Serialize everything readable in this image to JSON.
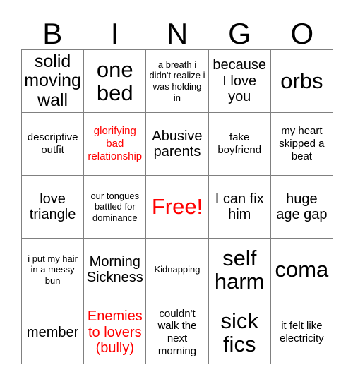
{
  "card": {
    "header_letters": [
      "B",
      "I",
      "N",
      "G",
      "O"
    ],
    "grid_line_color": "#808080",
    "accent_color": "#ff0000",
    "text_color": "#000000",
    "rows": [
      [
        {
          "text": "solid moving wall",
          "color": "black",
          "size": "lg"
        },
        {
          "text": "one bed",
          "color": "black",
          "size": "xl"
        },
        {
          "text": "a breath i didn't realize i was holding in",
          "color": "black",
          "size": "xs"
        },
        {
          "text": "because I love you",
          "color": "black",
          "size": "md"
        },
        {
          "text": "orbs",
          "color": "black",
          "size": "xl"
        }
      ],
      [
        {
          "text": "descriptive outfit",
          "color": "black",
          "size": "sm"
        },
        {
          "text": "glorifying bad relationship",
          "color": "red",
          "size": "sm"
        },
        {
          "text": "Abusive parents",
          "color": "black",
          "size": "md"
        },
        {
          "text": "fake boyfriend",
          "color": "black",
          "size": "sm"
        },
        {
          "text": "my heart skipped a beat",
          "color": "black",
          "size": "sm"
        }
      ],
      [
        {
          "text": "love triangle",
          "color": "black",
          "size": "md"
        },
        {
          "text": "our tongues battled for dominance",
          "color": "black",
          "size": "xs"
        },
        {
          "text": "Free!",
          "color": "red",
          "size": "xl"
        },
        {
          "text": "I can fix him",
          "color": "black",
          "size": "md"
        },
        {
          "text": "huge age gap",
          "color": "black",
          "size": "md"
        }
      ],
      [
        {
          "text": "i put my hair in a messy bun",
          "color": "black",
          "size": "xs"
        },
        {
          "text": "Morning Sickness",
          "color": "black",
          "size": "md"
        },
        {
          "text": "Kidnapping",
          "color": "black",
          "size": "xs"
        },
        {
          "text": "self harm",
          "color": "black",
          "size": "xl"
        },
        {
          "text": "coma",
          "color": "black",
          "size": "xl"
        }
      ],
      [
        {
          "text": "member",
          "color": "black",
          "size": "md"
        },
        {
          "text": "Enemies to lovers (bully)",
          "color": "red",
          "size": "md"
        },
        {
          "text": "couldn't walk the next morning",
          "color": "black",
          "size": "sm"
        },
        {
          "text": "sick fics",
          "color": "black",
          "size": "xl"
        },
        {
          "text": "it felt like electricity",
          "color": "black",
          "size": "sm"
        }
      ]
    ]
  }
}
